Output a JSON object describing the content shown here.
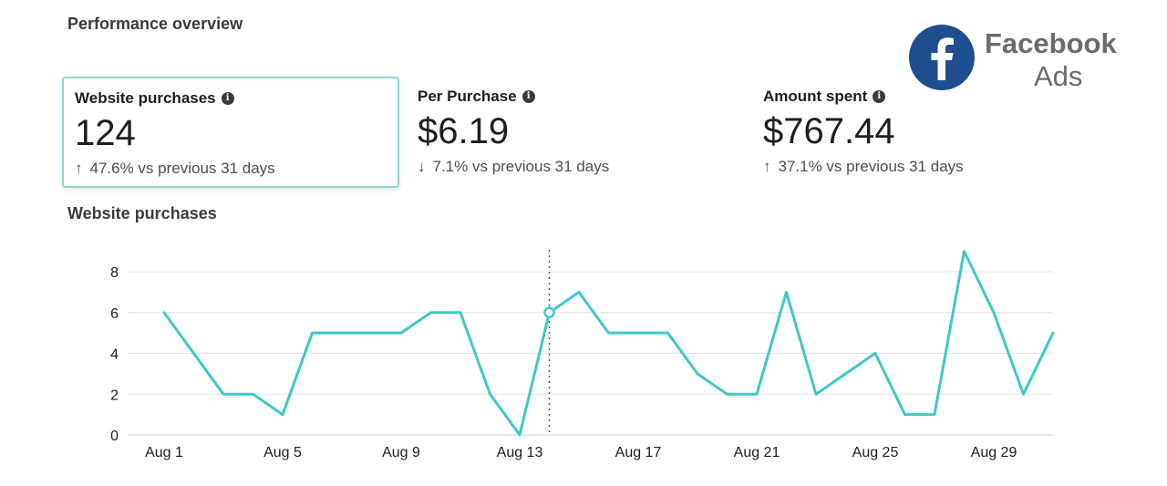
{
  "header": {
    "title": "Performance overview"
  },
  "brand": {
    "name": "Facebook",
    "sub": "Ads",
    "icon": "facebook-logo-icon",
    "color": "#1f4e8f"
  },
  "metrics": [
    {
      "label": "Website purchases",
      "value": "124",
      "delta": "47.6% vs previous 31 days",
      "direction": "up",
      "arrow": "↑",
      "selected": true
    },
    {
      "label": "Per Purchase",
      "value": "$6.19",
      "delta": "7.1% vs previous 31 days",
      "direction": "down",
      "arrow": "↓",
      "selected": false
    },
    {
      "label": "Amount spent",
      "value": "$767.44",
      "delta": "37.1% vs previous 31 days",
      "direction": "up",
      "arrow": "↑",
      "selected": false
    }
  ],
  "chart_title": "Website purchases",
  "chart_data": {
    "type": "line",
    "title": "Website purchases",
    "x": [
      "Aug 1",
      "Aug 2",
      "Aug 3",
      "Aug 4",
      "Aug 5",
      "Aug 6",
      "Aug 7",
      "Aug 8",
      "Aug 9",
      "Aug 10",
      "Aug 11",
      "Aug 12",
      "Aug 13",
      "Aug 14",
      "Aug 15",
      "Aug 16",
      "Aug 17",
      "Aug 18",
      "Aug 19",
      "Aug 20",
      "Aug 21",
      "Aug 22",
      "Aug 23",
      "Aug 24",
      "Aug 25",
      "Aug 26",
      "Aug 27",
      "Aug 28",
      "Aug 29",
      "Aug 30",
      "Aug 31"
    ],
    "values": [
      6,
      4,
      2,
      2,
      1,
      5,
      5,
      5,
      5,
      6,
      6,
      2,
      0,
      6,
      7,
      5,
      5,
      5,
      3,
      2,
      2,
      7,
      2,
      3,
      4,
      1,
      1,
      9,
      6,
      2,
      5
    ],
    "x_tick_labels": [
      "Aug 1",
      "Aug 5",
      "Aug 9",
      "Aug 13",
      "Aug 17",
      "Aug 21",
      "Aug 25",
      "Aug 29"
    ],
    "y_ticks": [
      0,
      2,
      4,
      6,
      8
    ],
    "ylim": [
      0,
      8
    ],
    "hover_index": 13,
    "line_color": "#3ec9c4",
    "grid": true,
    "legend": false
  }
}
